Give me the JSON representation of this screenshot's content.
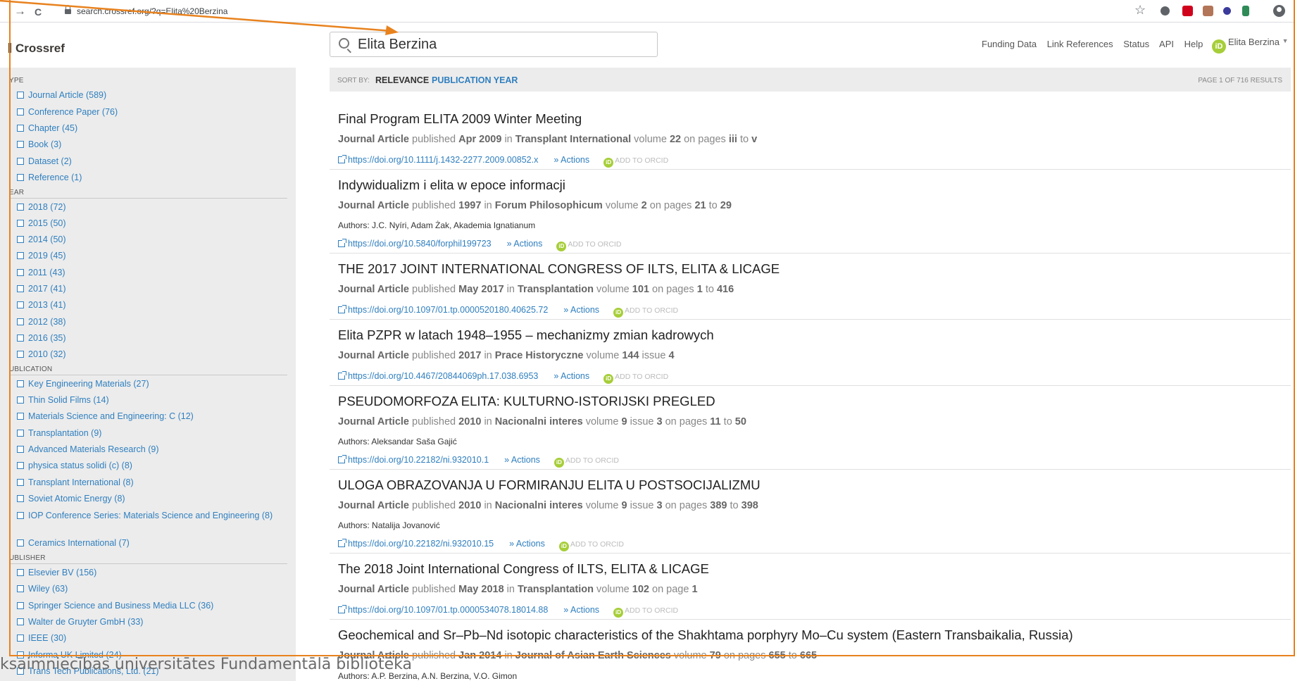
{
  "browser": {
    "url": "search.crossref.org/?q=Elita%20Berzina",
    "back": "→",
    "reload": "C",
    "star": "☆",
    "extensions": [
      {
        "name": "ext-circle-icon",
        "color": "#5f6368"
      },
      {
        "name": "ext-mendeley-icon",
        "color": "#d0021b"
      },
      {
        "name": "ext-pdf-icon",
        "color": "#a0522d"
      },
      {
        "name": "ext-hypothesis-icon",
        "color": "#3b3b9c"
      },
      {
        "name": "ext-green-icon",
        "color": "#2e8b57"
      }
    ]
  },
  "header": {
    "logo": "Crossref",
    "search_value": "Elita Berzina",
    "nav": [
      "Funding Data",
      "Link References",
      "Status",
      "API",
      "Help"
    ],
    "user": "Elita Berzina",
    "orcid_badge": "iD"
  },
  "sidebar": {
    "groups": [
      {
        "title": "YPE",
        "items": [
          "Journal Article (589)",
          "Conference Paper (76)",
          "Chapter (45)",
          "Book (3)",
          "Dataset (2)",
          "Reference (1)"
        ]
      },
      {
        "title": "EAR",
        "items": [
          "2018 (72)",
          "2015 (50)",
          "2014 (50)",
          "2019 (45)",
          "2011 (43)",
          "2017 (41)",
          "2013 (41)",
          "2012 (38)",
          "2016 (35)",
          "2010 (32)"
        ]
      },
      {
        "title": "UBLICATION",
        "items": [
          "Key Engineering Materials (27)",
          "Thin Solid Films (14)",
          "Materials Science and Engineering: C (12)",
          "Transplantation (9)",
          "Advanced Materials Research (9)",
          "physica status solidi (c) (8)",
          "Transplant International (8)",
          "Soviet Atomic Energy (8)",
          "IOP Conference Series: Materials Science and Engineering (8)",
          "Ceramics International (7)"
        ]
      },
      {
        "title": "UBLISHER",
        "items": [
          "Elsevier BV (156)",
          "Wiley (63)",
          "Springer Science and Business Media LLC (36)",
          "Walter de Gruyter GmbH (33)",
          "IEEE (30)",
          "Informa UK Limited (24)",
          "Trans Tech Publications, Ltd. (21)"
        ]
      }
    ]
  },
  "sortbar": {
    "label": "SORT BY:",
    "relevance": "RELEVANCE",
    "publication_year": "PUBLICATION YEAR",
    "page_info": "PAGE 1 OF 716 RESULTS"
  },
  "results": [
    {
      "title": "Final Program ELITA 2009 Winter Meeting",
      "type": "Journal Article",
      "published": "Apr 2009",
      "journal": "Transplant International",
      "volume": "22",
      "issue": "",
      "pages": [
        "iii",
        "v"
      ],
      "authors": "",
      "doi": "https://doi.org/10.1111/j.1432-2277.2009.00852.x"
    },
    {
      "title": "Indywidualizm i elita w epoce informacji",
      "type": "Journal Article",
      "published": "1997",
      "journal": "Forum Philosophicum",
      "volume": "2",
      "issue": "",
      "pages": [
        "21",
        "29"
      ],
      "authors": "Authors: J.C. Nyíri, Adam Żak, Akademia Ignatianum",
      "doi": "https://doi.org/10.5840/forphil199723"
    },
    {
      "title": "THE 2017 JOINT INTERNATIONAL CONGRESS OF ILTS, ELITA & LICAGE",
      "type": "Journal Article",
      "published": "May 2017",
      "journal": "Transplantation",
      "volume": "101",
      "issue": "",
      "pages": [
        "1",
        "416"
      ],
      "authors": "",
      "doi": "https://doi.org/10.1097/01.tp.0000520180.40625.72"
    },
    {
      "title": "Elita PZPR w latach 1948–1955 – mechanizmy zmian kadrowych",
      "type": "Journal Article",
      "published": "2017",
      "journal": "Prace Historyczne",
      "volume": "144",
      "issue": "4",
      "pages": [],
      "authors": "",
      "doi": "https://doi.org/10.4467/20844069ph.17.038.6953"
    },
    {
      "title": "PSEUDOMORFOZA ELITA: KULTURNO-ISTORIJSKI PREGLED",
      "type": "Journal Article",
      "published": "2010",
      "journal": "Nacionalni interes",
      "volume": "9",
      "issue": "3",
      "pages": [
        "11",
        "50"
      ],
      "authors": "Authors: Aleksandar Saša Gajić",
      "doi": "https://doi.org/10.22182/ni.932010.1"
    },
    {
      "title": "ULOGA OBRAZOVANJA U FORMIRANJU ELITA U POSTSOCIJALIZMU",
      "type": "Journal Article",
      "published": "2010",
      "journal": "Nacionalni interes",
      "volume": "9",
      "issue": "3",
      "pages": [
        "389",
        "398"
      ],
      "authors": "Authors: Natalija Jovanović",
      "doi": "https://doi.org/10.22182/ni.932010.15"
    },
    {
      "title": "The 2018 Joint International Congress of ILTS, ELITA & LICAGE",
      "type": "Journal Article",
      "published": "May 2018",
      "journal": "Transplantation",
      "volume": "102",
      "issue": "",
      "pages": [
        "1"
      ],
      "authors": "",
      "doi": "https://doi.org/10.1097/01.tp.0000534078.18014.88"
    },
    {
      "title": "Geochemical and Sr–Pb–Nd isotopic characteristics of the Shakhtama porphyry Mo–Cu system (Eastern Transbaikalia, Russia)",
      "type": "Journal Article",
      "published": "Jan 2014",
      "journal": "Journal of Asian Earth Sciences",
      "volume": "79",
      "issue": "",
      "pages": [
        "655",
        "665"
      ],
      "authors": "Authors: A.P. Berzina, A.N. Berzina, V.O. Gimon",
      "doi": ""
    }
  ],
  "result_labels": {
    "published": "published",
    "in": "in",
    "volume": "volume",
    "issue": "issue",
    "on_pages": "on pages",
    "on_page": "on page",
    "to": "to",
    "actions": "Actions",
    "add_to_orcid": "ADD TO ORCID"
  },
  "watermark": "ksaimniecības universitātes Fundamentālā bibliotēka",
  "colors": {
    "accent": "#2f7fbf",
    "orcid": "#a6ce39",
    "annotation": "#e8821e"
  }
}
